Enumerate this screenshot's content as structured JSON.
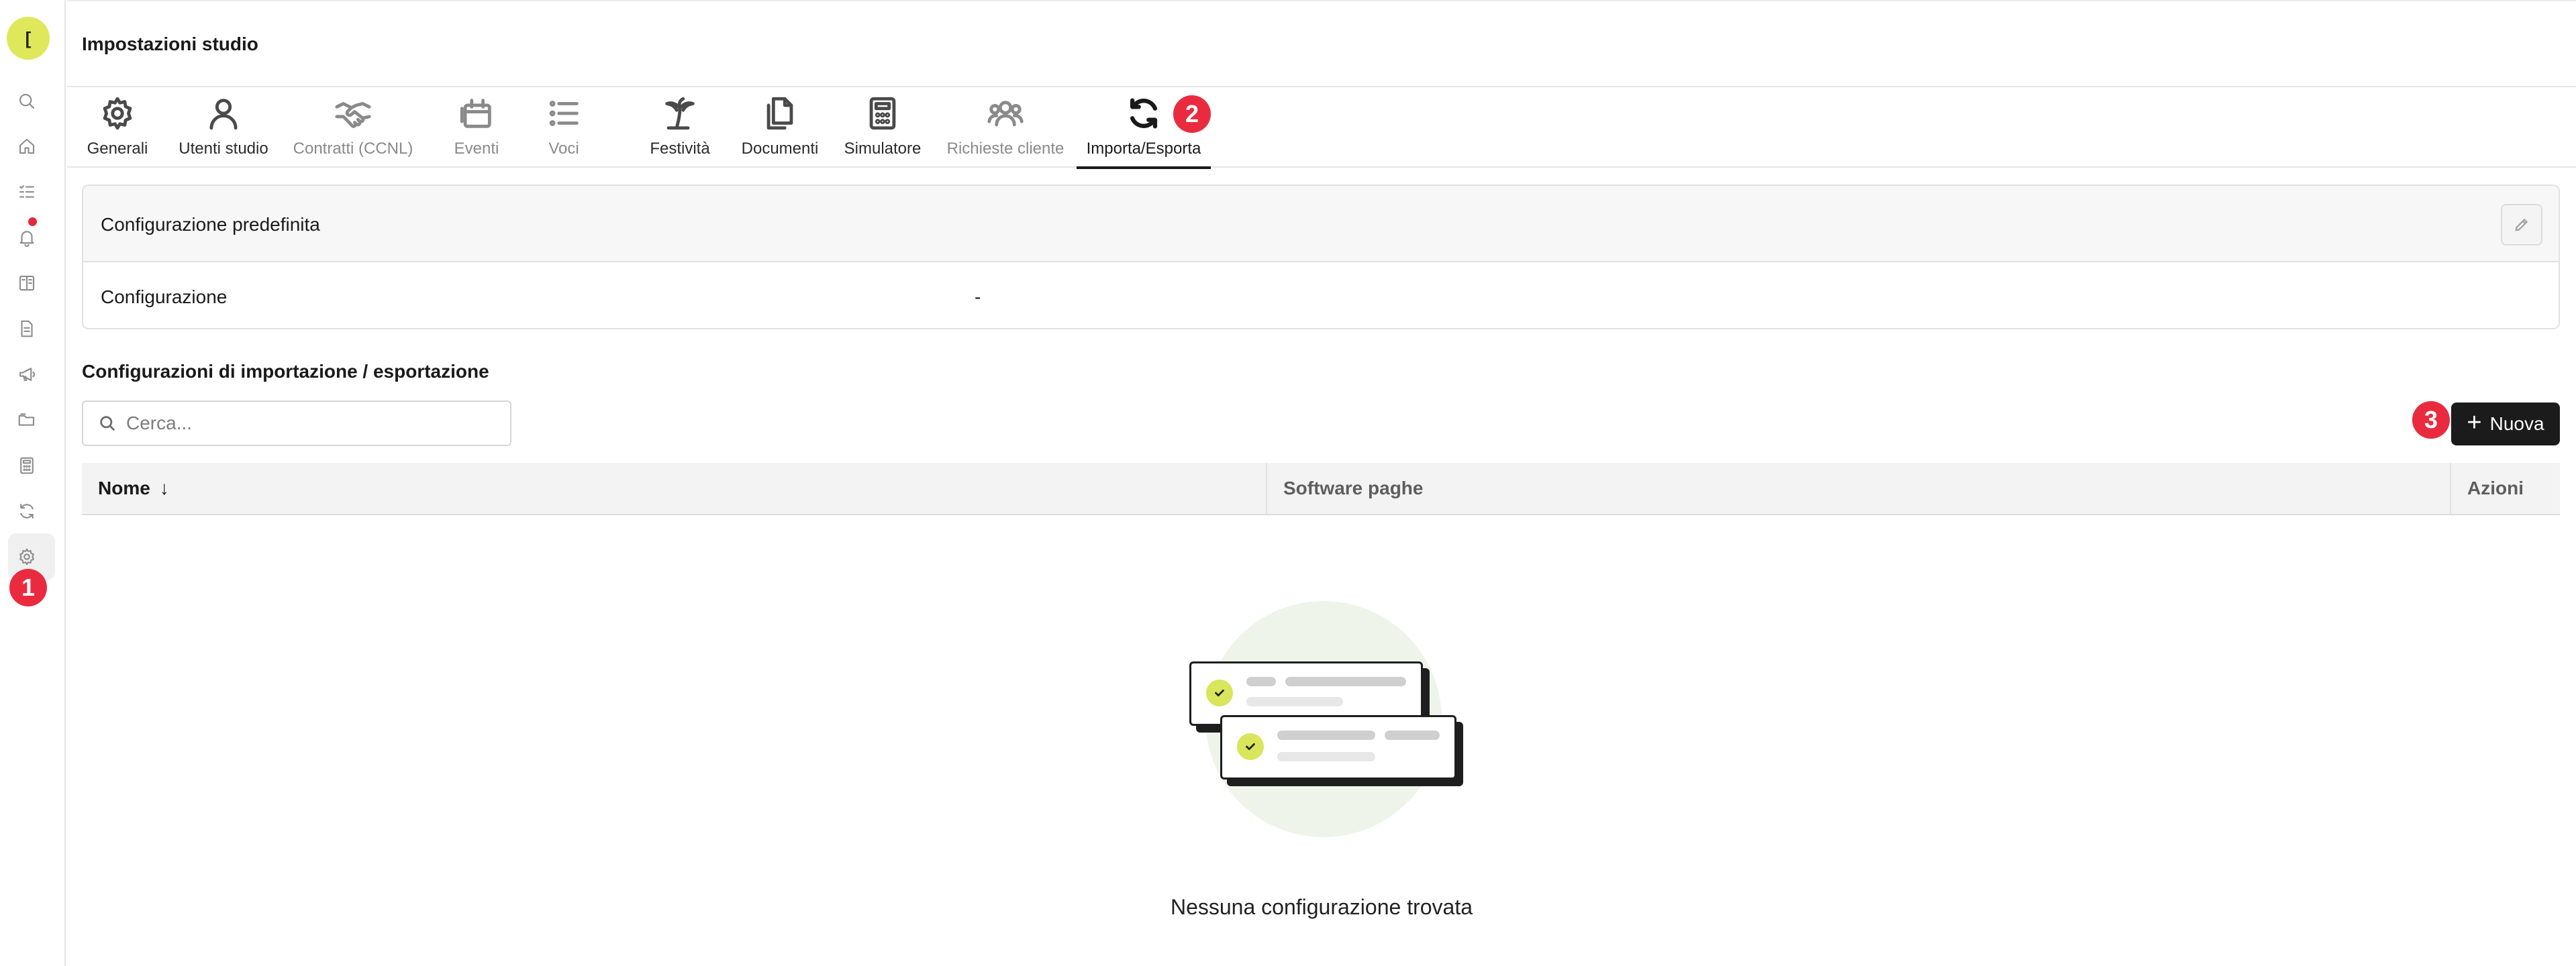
{
  "page": {
    "title": "Impostazioni studio"
  },
  "user": {
    "avatar_initial": "["
  },
  "rail": {
    "items": [
      {
        "icon": "search-icon"
      },
      {
        "icon": "home-icon"
      },
      {
        "icon": "task-list-icon"
      },
      {
        "icon": "bell-icon"
      },
      {
        "icon": "book-icon"
      },
      {
        "icon": "document-icon"
      },
      {
        "icon": "megaphone-icon"
      },
      {
        "icon": "folder-icon"
      },
      {
        "icon": "calculator-icon"
      },
      {
        "icon": "sync-icon"
      },
      {
        "icon": "gear-icon"
      }
    ],
    "active": "gear-icon"
  },
  "tabs": [
    {
      "label": "Generali",
      "icon": "gear-icon",
      "state": "normal"
    },
    {
      "label": "Utenti studio",
      "icon": "user-icon",
      "state": "normal"
    },
    {
      "label": "Contratti (CCNL)",
      "icon": "handshake-icon",
      "state": "muted"
    },
    {
      "label": "Eventi",
      "icon": "calendar-icon",
      "state": "muted"
    },
    {
      "label": "Voci",
      "icon": "list-icon",
      "state": "muted"
    },
    {
      "label": "Festività",
      "icon": "palm-tree-icon",
      "state": "normal"
    },
    {
      "label": "Documenti",
      "icon": "documents-icon",
      "state": "normal"
    },
    {
      "label": "Simulatore",
      "icon": "calculator-icon",
      "state": "normal"
    },
    {
      "label": "Richieste cliente",
      "icon": "users-icon",
      "state": "muted"
    },
    {
      "label": "Importa/Esporta",
      "icon": "sync-icon",
      "state": "active"
    }
  ],
  "default_config": {
    "title": "Configurazione predefinita",
    "row_label": "Configurazione",
    "row_value": "-"
  },
  "section": {
    "title": "Configurazioni di importazione / esportazione"
  },
  "search": {
    "placeholder": "Cerca..."
  },
  "new_button": {
    "label": "Nuova"
  },
  "table": {
    "columns": [
      "Nome",
      "Software paghe",
      "Azioni"
    ],
    "sort_indicator": "↓",
    "empty_message": "Nessuna configurazione trovata"
  },
  "badges": {
    "one": "1",
    "two": "2",
    "three": "3"
  },
  "colors": {
    "accent": "#dfe85a",
    "badge": "#ea2b3f",
    "primary_button": "#1b1b1b"
  }
}
